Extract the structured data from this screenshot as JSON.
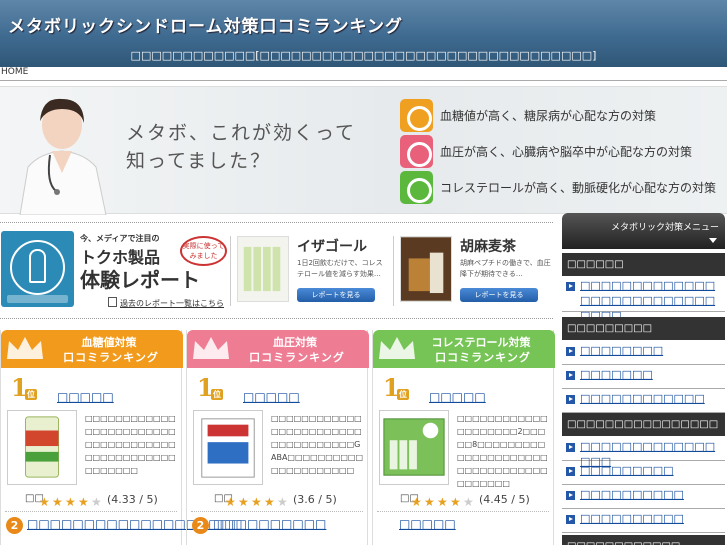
{
  "header": {
    "title": "メタボリックシンドローム対策口コミランキング",
    "subtitle": "□□□□□□□□□□□□[□□□□□□□□□□□□□□□□□□□□□□□□□□□□□□□□]"
  },
  "breadcrumb": {
    "home": "HOME"
  },
  "banner": {
    "headline_line1": "メタボ、これが効くって",
    "headline_line2": "知ってました？",
    "measures": [
      {
        "label": "血糖値が高く、糖尿病が心配な方の対策",
        "color": "#f0a020"
      },
      {
        "label": "血圧が高く、心臓病や脳卒中が心配な方の対策",
        "color": "#e8607a"
      },
      {
        "label": "コレステロールが高く、動脈硬化が心配な方の対策",
        "color": "#5cb83c"
      }
    ]
  },
  "tokuho": {
    "kicker": "今、メディアで注目の",
    "title1": "トクホ製品",
    "title2": "体験レポート",
    "bubble": "実際に使ってみました",
    "past_link": "過去のレポート一覧はこちら",
    "products": [
      {
        "name": "イザゴール",
        "desc": "1日2回飲むだけで、コレステロール値を減らす効果…",
        "button": "レポートを見る"
      },
      {
        "name": "胡麻麦茶",
        "desc": "胡麻ペプチドの働きで、血圧降下が期待できる…",
        "button": "レポートを見る"
      }
    ]
  },
  "rankings": [
    {
      "head1": "血糖値対策",
      "head2": "口コミランキング",
      "color": "#f29a1c",
      "rank1_mark": "1",
      "rank_suffix": "位",
      "rank1_name": "□□□□□",
      "rank1_desc": "□□□□□□□□□□□□□□□□□□□□□□□□□□□□□□□□□□□□□□□□□□□□□□□□□□□□□□□",
      "rating_label": "□□",
      "stars": 4.33,
      "score": "(4.33 / 5)",
      "rank2_mark": "2",
      "rank2_name": "□□□□□□□□□□□□□□□□□□□"
    },
    {
      "head1": "血圧対策",
      "head2": "口コミランキング",
      "color": "#ee7c93",
      "rank1_mark": "1",
      "rank_suffix": "位",
      "rank1_name": "□□□□□",
      "rank1_desc": "□□□□□□□□□□□□□□□□□□□□□□□□□□□□□□□□□□□GABA□□□□□□□□□□□□□□□□□□□□□",
      "rating_label": "□□",
      "stars": 3.6,
      "score": "(3.6 / 5)",
      "rank2_mark": "2",
      "rank2_name": "□□□□□□□□□□"
    },
    {
      "head1": "コレステロール対策",
      "head2": "口コミランキング",
      "color": "#77c456",
      "rank1_mark": "1",
      "rank_suffix": "位",
      "rank1_name": "□□□□□",
      "rank1_desc": "□□□□□□□□□□□□□□□□□□□□2□□□□□8□□□□□□□□□□□□□□□□□□□□□□□□□□□□□□□□□□□□□□□□",
      "rating_label": "□□",
      "stars": 4.45,
      "score": "(4.45 / 5)",
      "rank2_name": "□□□□□"
    }
  ],
  "sidebar": {
    "title": "メタボリック対策メニュー",
    "sections": [
      {
        "title": "□□□□□□",
        "items": [
          "□□□□□□□□□□□□□□□□□□□□□□□□□□□□□□"
        ]
      },
      {
        "title": "□□□□□□□□□",
        "items": [
          "□□□□□□□□",
          "□□□□□□□",
          "□□□□□□□□□□□□"
        ]
      },
      {
        "title": "□□□□□□□□□□□□□□□□",
        "items": [
          "□□□□□□□□□□□□□□□□",
          "□□□□□□□□□",
          "□□□□□□□□□□",
          "□□□□□□□□□□"
        ]
      },
      {
        "title": "□□□□□□□□□□□□"
      }
    ]
  },
  "colors": {
    "header": "#3f6a90",
    "link": "#124a9c",
    "star_on": "#e8a020",
    "star_off": "#cccccc"
  }
}
